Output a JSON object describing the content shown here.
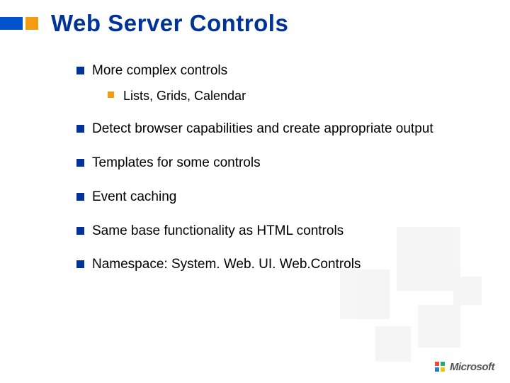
{
  "title": "Web Server Controls",
  "bullets": [
    {
      "text": "More complex controls",
      "sub": [
        "Lists, Grids, Calendar"
      ]
    },
    {
      "text": "Detect browser capabilities and create appropriate output"
    },
    {
      "text": "Templates for some controls"
    },
    {
      "text": "Event caching"
    },
    {
      "text": "Same base functionality as HTML controls"
    },
    {
      "text": "Namespace: System. Web. UI. Web.Controls"
    }
  ],
  "footer": {
    "logo_text": "Microsoft"
  }
}
